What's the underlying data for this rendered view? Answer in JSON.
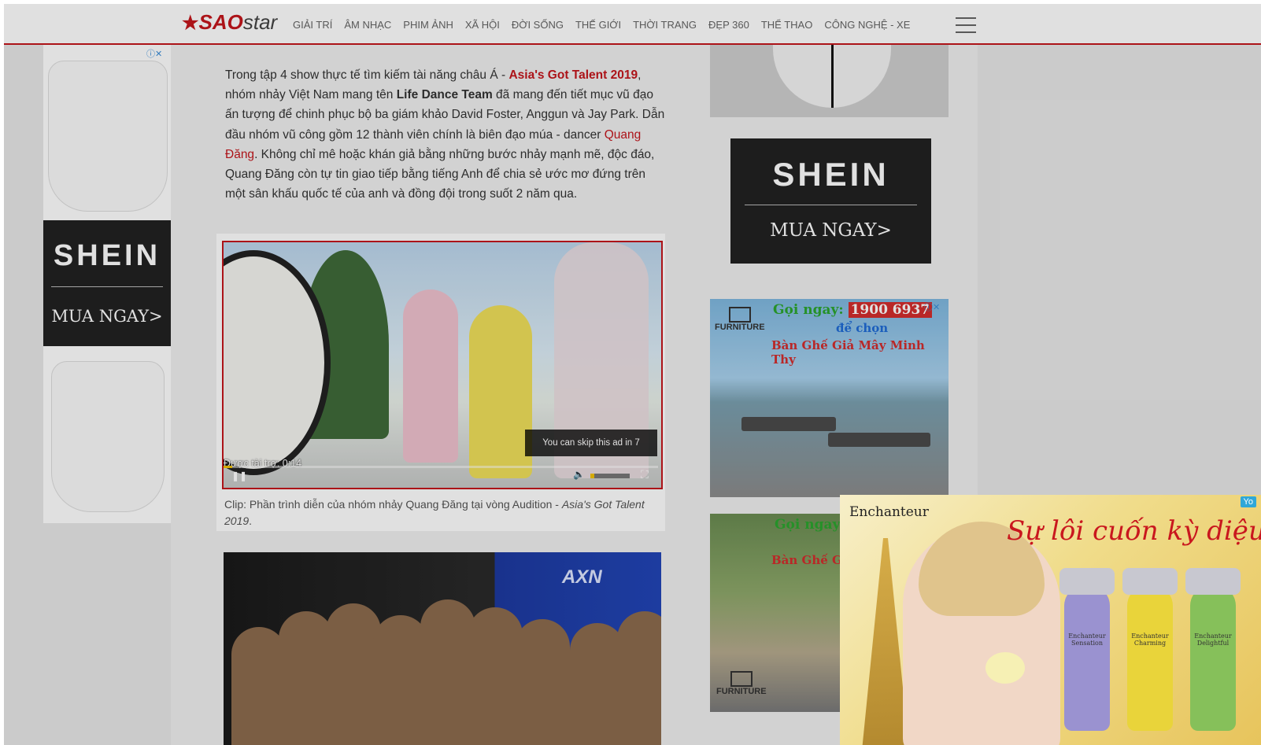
{
  "header": {
    "logo_main": "SAO",
    "logo_suffix": "star",
    "nav": [
      "GIẢI TRÍ",
      "ÂM NHẠC",
      "PHIM ẢNH",
      "XÃ HỘI",
      "ĐỜI SỐNG",
      "THẾ GIỚI",
      "THỜI TRANG",
      "ĐẸP 360",
      "THỂ THAO",
      "CÔNG NGHỆ - XE"
    ]
  },
  "article": {
    "p1_a": "Trong tập 4 show thực tế tìm kiếm tài năng châu Á - ",
    "p1_link1": "Asia's Got Talent 2019",
    "p1_b": ", nhóm nhảy Việt Nam mang tên ",
    "p1_bold": "Life Dance Team",
    "p1_c": " đã mang đến tiết mục vũ đạo ấn tượng để chinh phục bộ ba giám khảo David Foster, Anggun và Jay Park. Dẫn đầu nhóm vũ công gồm 12 thành viên chính là biên đạo múa - dancer ",
    "p1_link2": "Quang Đăng",
    "p1_d": ". Không chỉ mê hoặc khán giả bằng những bước nhảy mạnh mẽ, độc đáo, Quang Đăng còn tự tin giao tiếp bằng tiếng Anh để chia sẻ ước mơ đứng trên một sân khấu quốc tế của anh và đồng đội trong suốt 2 năm qua.",
    "caption_a": "Clip: Phần trình diễn của nhóm nhảy Quang Đăng tại vòng Audition - ",
    "caption_em": "Asia's Got Talent 2019",
    "caption_b": "."
  },
  "video": {
    "skip_text": "You can skip this ad in 7",
    "sponsored_text": "Được tài trợ: 0:14",
    "progress": 0.02,
    "volume": 0.1,
    "play_icon": "pause-icon",
    "volume_icon": "volume-icon",
    "fullscreen_icon": "fullscreen-icon"
  },
  "second_image": {
    "channel_logo": "AXN"
  },
  "ads": {
    "shein_word": "SHEIN",
    "shein_buy": "MUA NGAY>",
    "furniture_phone_label": "Gọi ngay:",
    "furniture_phone": "1900 6937",
    "furniture_choose": "để chọn",
    "furniture_title": "Bàn Ghế Giả Mây Minh Thy",
    "furniture_brand": "FURNITURE",
    "furniture2_phone_label": "Gọi ngay",
    "furniture2_title": "Bàn Ghế G",
    "ench_brand": "Enchanteur",
    "ench_slogan": "Sự lôi cuốn kỳ diệu",
    "ench_bottle1": "Enchanteur Sensation",
    "ench_bottle2": "Enchanteur Charming",
    "ench_bottle3": "Enchanteur Delightful",
    "ench_badge": "Yo"
  },
  "colors": {
    "brand_red": "#c4161c",
    "link_red": "#c4161c",
    "progress_yellow": "#f2c200"
  }
}
